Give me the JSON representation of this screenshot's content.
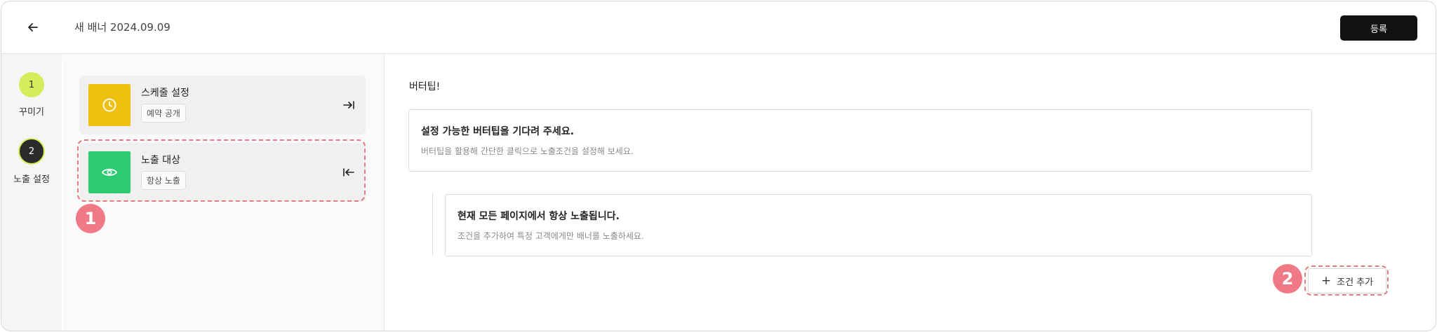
{
  "header": {
    "title": "새 배너 2024.09.09",
    "register_label": "등록"
  },
  "steps": [
    {
      "number": "1",
      "label": "꾸미기"
    },
    {
      "number": "2",
      "label": "노출 설정"
    }
  ],
  "cards": [
    {
      "title": "스케줄 설정",
      "chip": "예약 공개",
      "icon": "clock-icon",
      "color": "#f0c010",
      "action_icon": "expand-right-icon"
    },
    {
      "title": "노출 대상",
      "chip": "항상 노출",
      "icon": "eye-icon",
      "color": "#2ecc71",
      "action_icon": "collapse-left-icon"
    }
  ],
  "annotations": {
    "badge1": "1",
    "badge2": "2",
    "color": "#ef7a86"
  },
  "content": {
    "section_title": "버터팁!",
    "tip_heading": "설정 가능한 버터팁을 기다려 주세요.",
    "tip_sub": "버터팁을 활용해 간단한 클릭으로 노출조건을 설정해 보세요.",
    "status_heading": "현재 모든 페이지에서 항상 노출됩니다.",
    "status_sub": "조건을 추가하여 특정 고객에게만 배너를 노출하세요.",
    "add_condition_label": "조건 추가"
  }
}
